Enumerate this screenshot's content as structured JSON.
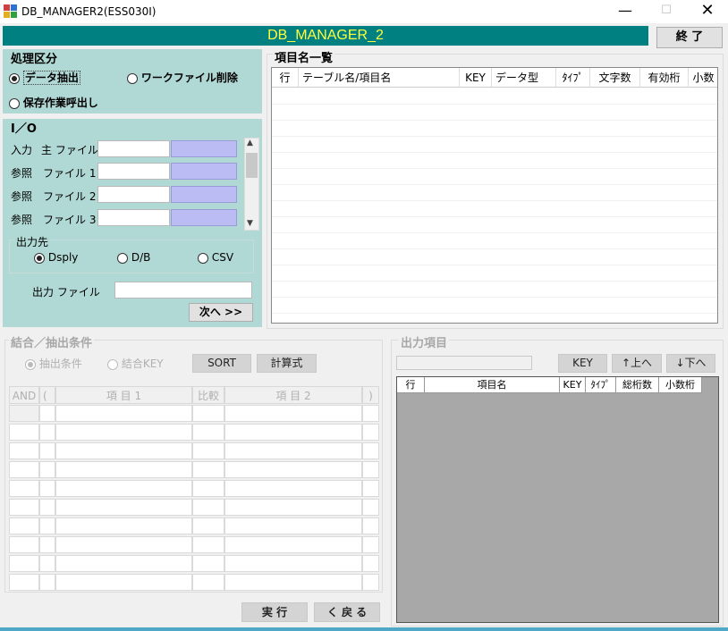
{
  "window": {
    "title": "DB_MANAGER2(ESS030I)",
    "min_glyph": "—",
    "max_glyph": "☐",
    "close_glyph": "✕"
  },
  "header": {
    "app_name": "DB_MANAGER_2",
    "exit_label": "終 了"
  },
  "processing": {
    "title": "処理区分",
    "options": [
      {
        "label": "データ抽出",
        "selected": true
      },
      {
        "label": "ワークファイル削除",
        "selected": false
      },
      {
        "label": "保存作業呼出し",
        "selected": false
      }
    ]
  },
  "io": {
    "title": "I／O",
    "rows": [
      {
        "kind": "入力",
        "name": "主 ファイル"
      },
      {
        "kind": "参照",
        "name": "ファイル 1"
      },
      {
        "kind": "参照",
        "name": "ファイル 2"
      },
      {
        "kind": "参照",
        "name": "ファイル 3"
      }
    ],
    "output_dest": {
      "title": "出力先",
      "options": [
        {
          "label": "Dsply",
          "selected": true
        },
        {
          "label": "D/B",
          "selected": false
        },
        {
          "label": "CSV",
          "selected": false
        }
      ]
    },
    "output_file_label": "出力 ファイル",
    "output_file_value": "",
    "next_label": "次へ >>"
  },
  "item_list": {
    "title": "項目名一覧",
    "columns": [
      "行",
      "テーブル名/項目名",
      "KEY",
      "データ型",
      "ﾀｲﾌﾟ",
      "文字数",
      "有効桁",
      "小数"
    ]
  },
  "join": {
    "title": "結合／抽出条件",
    "options": [
      {
        "label": "抽出条件",
        "selected": true
      },
      {
        "label": "結合KEY",
        "selected": false
      }
    ],
    "sort_label": "SORT",
    "calc_label": "計算式",
    "columns": [
      "AND",
      "(",
      "項 目 1",
      "比較",
      "項 目 2",
      ")"
    ]
  },
  "output_items": {
    "title": "出力項目",
    "key_label": "KEY",
    "up_label": "↑上へ",
    "down_label": "↓下へ",
    "columns": [
      "行",
      "項目名",
      "KEY",
      "ﾀｲﾌﾟ",
      "総桁数",
      "小数桁"
    ]
  },
  "actions": {
    "run_label": "実 行",
    "back_label": "く 戻 る"
  },
  "colors": {
    "header_bg": "#008080",
    "header_text": "#ffff40",
    "panel_bg": "#b0d8d4",
    "blue_field": "#bcbcf4"
  }
}
